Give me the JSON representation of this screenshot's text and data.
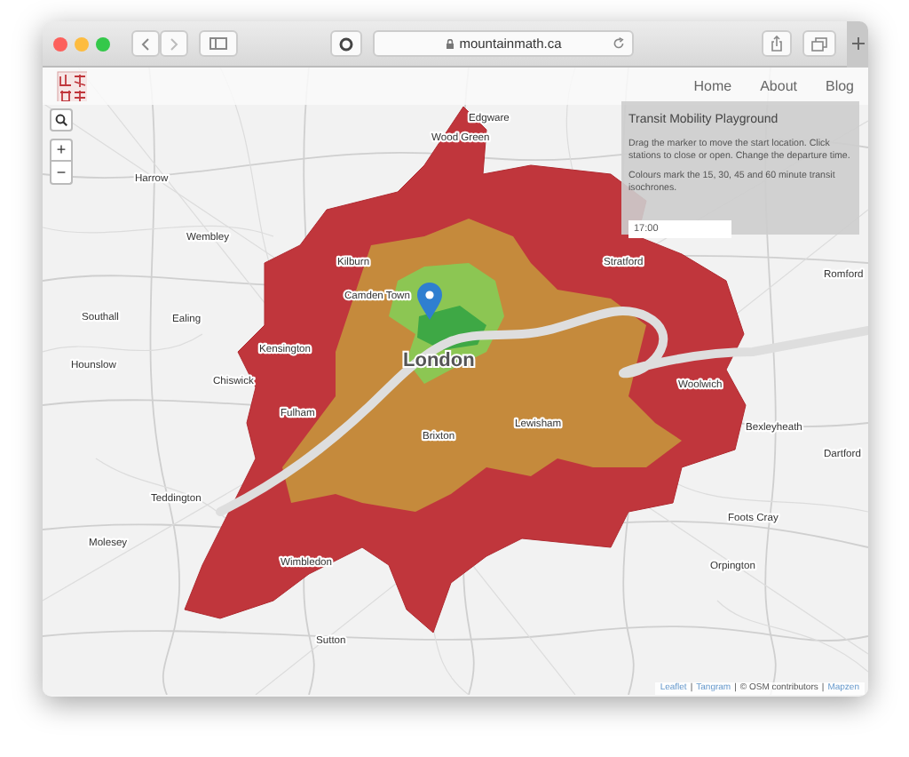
{
  "browser": {
    "url": "mountainmath.ca"
  },
  "nav": {
    "links": [
      {
        "label": "Home"
      },
      {
        "label": "About"
      },
      {
        "label": "Blog"
      }
    ]
  },
  "zoom_controls": {
    "zoom_in": "+",
    "zoom_out": "−"
  },
  "map": {
    "places": [
      {
        "name": "Edgware",
        "kind": "town"
      },
      {
        "name": "Wood Green",
        "kind": "town"
      },
      {
        "name": "Harrow",
        "kind": "town"
      },
      {
        "name": "Wembley",
        "kind": "town"
      },
      {
        "name": "Southall",
        "kind": "town"
      },
      {
        "name": "Ealing",
        "kind": "town"
      },
      {
        "name": "Hounslow",
        "kind": "town"
      },
      {
        "name": "Chiswick",
        "kind": "town"
      },
      {
        "name": "Kensington",
        "kind": "town"
      },
      {
        "name": "Fulham",
        "kind": "town"
      },
      {
        "name": "Kilburn",
        "kind": "town"
      },
      {
        "name": "Camden Town",
        "kind": "town"
      },
      {
        "name": "Stratford",
        "kind": "town"
      },
      {
        "name": "Romford",
        "kind": "town"
      },
      {
        "name": "London",
        "kind": "city"
      },
      {
        "name": "Brixton",
        "kind": "town"
      },
      {
        "name": "Lewisham",
        "kind": "town"
      },
      {
        "name": "Woolwich",
        "kind": "town"
      },
      {
        "name": "Bexleyheath",
        "kind": "town"
      },
      {
        "name": "Dartford",
        "kind": "town"
      },
      {
        "name": "Teddington",
        "kind": "town"
      },
      {
        "name": "Molesey",
        "kind": "town"
      },
      {
        "name": "Wimbledon",
        "kind": "town"
      },
      {
        "name": "Foots Cray",
        "kind": "town"
      },
      {
        "name": "Orpington",
        "kind": "town"
      },
      {
        "name": "Sutton",
        "kind": "town"
      }
    ]
  },
  "panel": {
    "title": "Transit Mobility Playground",
    "paragraphs": [
      "Drag the marker to move the start location. Click stations to close or open. Change the departure time.",
      "Colours mark the 15, 30, 45 and 60 minute transit isochrones."
    ],
    "time": {
      "value": "17:00"
    }
  },
  "attribution": [
    {
      "text": "Leaflet",
      "kind": "link"
    },
    {
      "text": "|",
      "kind": "separator"
    },
    {
      "text": "Tangram",
      "kind": "link"
    },
    {
      "text": "|",
      "kind": "separator"
    },
    {
      "text": "© OSM contributors",
      "kind": "text"
    },
    {
      "text": "|",
      "kind": "separator"
    },
    {
      "text": "Mapzen",
      "kind": "link"
    }
  ]
}
